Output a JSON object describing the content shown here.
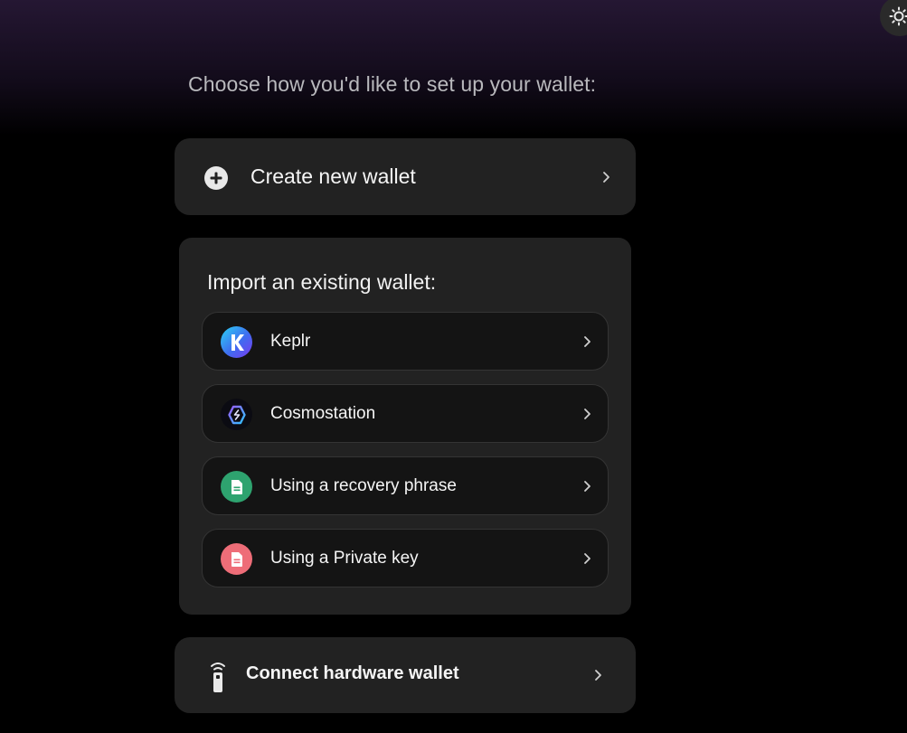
{
  "heading": "Choose how you'd like to set up your wallet:",
  "create": {
    "label": "Create new wallet",
    "icon": "plus-circle-icon"
  },
  "import": {
    "title": "Import an existing wallet:",
    "options": [
      {
        "label": "Keplr",
        "icon": "keplr-logo-icon"
      },
      {
        "label": "Cosmostation",
        "icon": "cosmostation-logo-icon"
      },
      {
        "label": "Using a recovery phrase",
        "icon": "document-icon",
        "color": "#2ea36f"
      },
      {
        "label": "Using a Private key",
        "icon": "document-icon",
        "color": "#ee6d78"
      }
    ]
  },
  "hardware": {
    "label": "Connect hardware wallet",
    "icon": "hardware-device-icon"
  },
  "theme_toggle": {
    "icon": "sun-icon"
  },
  "colors": {
    "card_bg": "#222222",
    "option_bg": "#141414",
    "heading_text": "#b9b9bd",
    "gradient_top": "#251733"
  }
}
